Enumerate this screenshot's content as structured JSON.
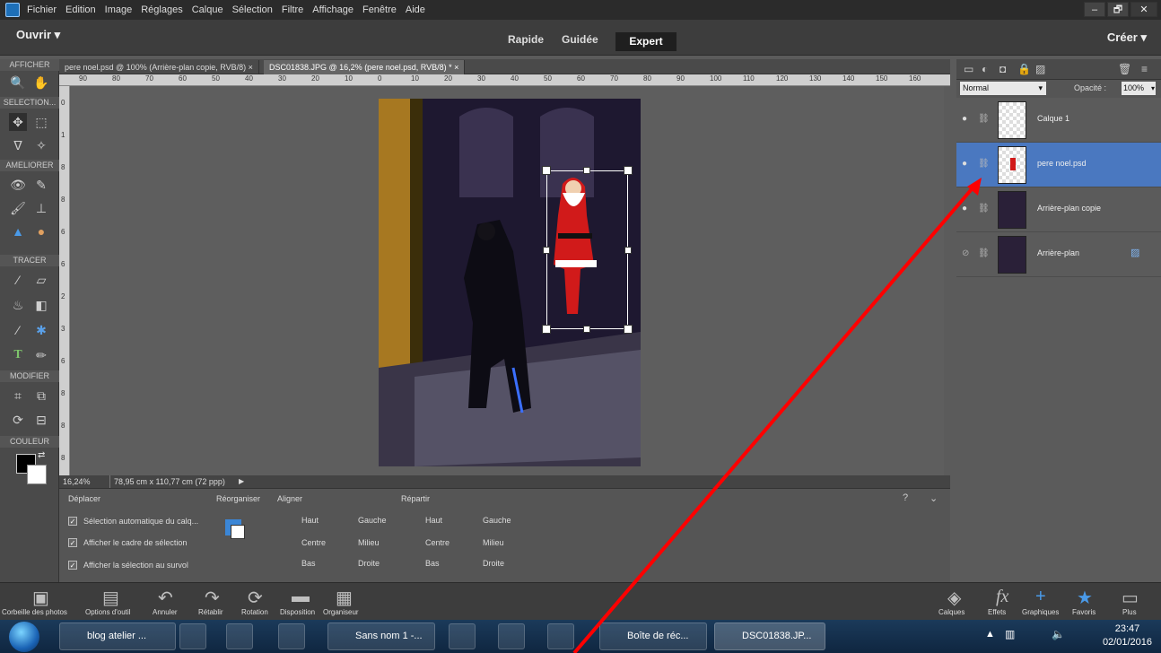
{
  "menubar": {
    "items": [
      "Fichier",
      "Edition",
      "Image",
      "Réglages",
      "Calque",
      "Sélection",
      "Filtre",
      "Affichage",
      "Fenêtre",
      "Aide"
    ],
    "window_controls": [
      "–",
      "🗗",
      "✕"
    ]
  },
  "modebar": {
    "open": "Ouvrir",
    "tabs": [
      "Rapide",
      "Guidée",
      "Expert"
    ],
    "active_tab": "Expert",
    "create": "Créer"
  },
  "toolbar": {
    "sections": [
      "AFFICHER",
      "SELECTION...",
      "AMELIORER",
      "TRACER",
      "MODIFIER",
      "COULEUR"
    ]
  },
  "documents": {
    "tabs": [
      "pere noel.psd @ 100% (Arrière-plan copie, RVB/8) ×",
      "DSC01838.JPG @ 16,2% (pere noel.psd, RVB/8) * ×"
    ],
    "active": 1
  },
  "ruler": {
    "h_ticks": [
      "90",
      "80",
      "70",
      "60",
      "50",
      "40",
      "30",
      "20",
      "10",
      "0",
      "10",
      "20",
      "30",
      "40",
      "50",
      "60",
      "70",
      "80",
      "90",
      "100",
      "110",
      "120",
      "130",
      "140",
      "150",
      "160"
    ],
    "v_ticks": [
      "0",
      "1",
      "8",
      "8",
      "6",
      "6",
      "2",
      "3",
      "6",
      "8",
      "8",
      "8"
    ]
  },
  "status": {
    "zoom": "16,24%",
    "size": "78,95 cm x 110,77 cm (72 ppp)"
  },
  "options": {
    "move_title": "Déplacer",
    "checks": [
      "Sélection automatique du calq...",
      "Afficher le cadre de sélection",
      "Afficher la sélection au survol"
    ],
    "reorganize": "Réorganiser",
    "align": {
      "title": "Aligner",
      "items": [
        "Haut",
        "Centre",
        "Bas",
        "Gauche",
        "Milieu",
        "Droite"
      ]
    },
    "distribute": {
      "title": "Répartir",
      "items": [
        "Haut",
        "Centre",
        "Bas",
        "Gauche",
        "Milieu",
        "Droite"
      ]
    }
  },
  "layers": {
    "blend_mode": "Normal",
    "opacity_label": "Opacité :",
    "opacity": "100%",
    "items": [
      {
        "name": "Calque 1",
        "selected": false
      },
      {
        "name": "pere noel.psd",
        "selected": true
      },
      {
        "name": "Arrière-plan copie",
        "selected": false
      },
      {
        "name": "Arrière-plan",
        "selected": false
      }
    ]
  },
  "bottombar": {
    "left": [
      "Corbeille des photos",
      "Options d'outil",
      "Annuler",
      "Rétablir",
      "Rotation",
      "Disposition",
      "Organiseur"
    ],
    "right": [
      "Calques",
      "Effets",
      "Graphiques",
      "Favoris",
      "Plus"
    ]
  },
  "taskbar": {
    "items": [
      "blog atelier ...",
      "Sans nom 1 -...",
      "Boîte de réc...",
      "DSC01838.JP..."
    ],
    "time": "23:47",
    "date": "02/01/2016"
  },
  "colors": {
    "accent_selected": "#4a78c0",
    "annotation_arrow": "#ff0000"
  }
}
